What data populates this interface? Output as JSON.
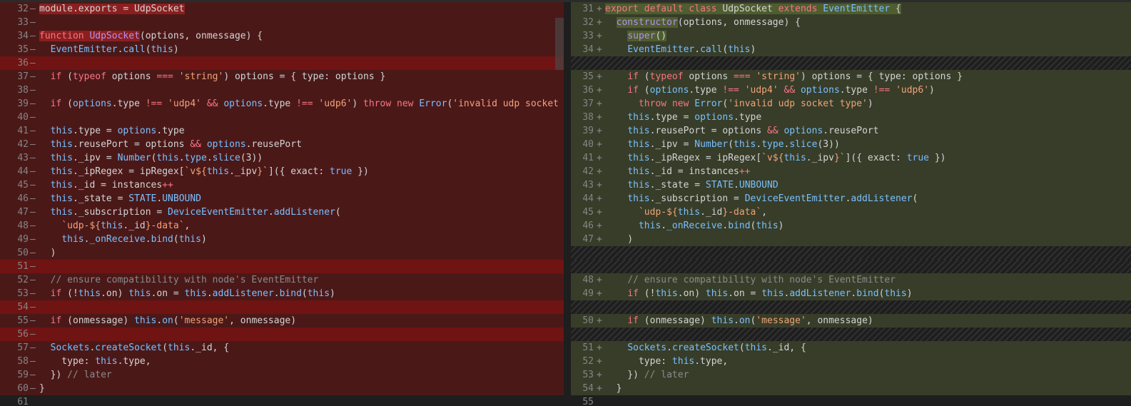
{
  "left": {
    "rows": [
      {
        "num": "32",
        "mk": "—",
        "bg": "del",
        "html": "<span class='hl-del'>module.exports = UdpSocket</span>"
      },
      {
        "num": "33",
        "mk": "—",
        "bg": "del",
        "html": ""
      },
      {
        "num": "34",
        "mk": "—",
        "bg": "del",
        "html": "<span class='hl-del'><span class='k'>function</span> <span class='pl'>UdpSocket</span></span>(options, onmessage) {"
      },
      {
        "num": "35",
        "mk": "—",
        "bg": "del",
        "html": "  <span class='t'>EventEmitter</span>.<span class='t'>call</span>(<span class='t'>this</span>)"
      },
      {
        "num": "36",
        "mk": "—",
        "bg": "gap",
        "html": ""
      },
      {
        "num": "37",
        "mk": "—",
        "bg": "del",
        "html": "  <span class='k'>if</span> (<span class='k'>typeof</span> options <span class='k'>===</span> <span class='s'>'string'</span>) options = { type: options }"
      },
      {
        "num": "38",
        "mk": "—",
        "bg": "del",
        "html": ""
      },
      {
        "num": "39",
        "mk": "—",
        "bg": "del",
        "html": "  <span class='k'>if</span> (<span class='t'>options</span>.type <span class='k'>!==</span> <span class='s'>'udp4'</span> <span class='k'>&amp;&amp;</span> <span class='t'>options</span>.type <span class='k'>!==</span> <span class='s'>'udp6'</span>) <span class='k'>throw</span> <span class='k'>new</span> <span class='t'>Error</span>(<span class='s'>'invalid udp socket typ</span>"
      },
      {
        "num": "40",
        "mk": "—",
        "bg": "del",
        "html": ""
      },
      {
        "num": "41",
        "mk": "—",
        "bg": "del",
        "html": "  <span class='t'>this</span>.type = <span class='t'>options</span>.type"
      },
      {
        "num": "42",
        "mk": "—",
        "bg": "del",
        "html": "  <span class='t'>this</span>.reusePort = options <span class='k'>&amp;&amp;</span> <span class='t'>options</span>.reusePort"
      },
      {
        "num": "43",
        "mk": "—",
        "bg": "del",
        "html": "  <span class='t'>this</span>._ipv = <span class='t'>Number</span>(<span class='t'>this</span>.<span class='t'>type</span>.<span class='t'>slice</span>(3))"
      },
      {
        "num": "44",
        "mk": "—",
        "bg": "del",
        "html": "  <span class='t'>this</span>._ipRegex = ipRegex[<span class='s'>`v${</span><span class='t'>this</span>._ipv<span class='s'>}`</span>]({ exact: <span class='n'>true</span> })"
      },
      {
        "num": "45",
        "mk": "—",
        "bg": "del",
        "html": "  <span class='t'>this</span>._id = instances<span class='k'>++</span>"
      },
      {
        "num": "46",
        "mk": "—",
        "bg": "del",
        "html": "  <span class='t'>this</span>._state = <span class='t'>STATE</span>.<span class='t'>UNBOUND</span>"
      },
      {
        "num": "47",
        "mk": "—",
        "bg": "del",
        "html": "  <span class='t'>this</span>._subscription = <span class='t'>DeviceEventEmitter</span>.<span class='t'>addListener</span>("
      },
      {
        "num": "48",
        "mk": "—",
        "bg": "del",
        "html": "    <span class='s'>`udp-${</span><span class='t'>this</span>._id<span class='s'>}-data`</span>,"
      },
      {
        "num": "49",
        "mk": "—",
        "bg": "del",
        "html": "    <span class='t'>this</span>.<span class='t'>_onReceive</span>.<span class='t'>bind</span>(<span class='t'>this</span>)"
      },
      {
        "num": "50",
        "mk": "—",
        "bg": "del",
        "html": "  )"
      },
      {
        "num": "51",
        "mk": "—",
        "bg": "gap",
        "html": ""
      },
      {
        "num": "52",
        "mk": "—",
        "bg": "del",
        "html": "  <span class='c'>// ensure compatibility with node's EventEmitter</span>"
      },
      {
        "num": "53",
        "mk": "—",
        "bg": "del",
        "html": "  <span class='k'>if</span> (!<span class='t'>this</span>.on) <span class='t'>this</span>.on = <span class='t'>this</span>.<span class='t'>addListener</span>.<span class='t'>bind</span>(<span class='t'>this</span>)"
      },
      {
        "num": "54",
        "mk": "—",
        "bg": "gap",
        "html": ""
      },
      {
        "num": "55",
        "mk": "—",
        "bg": "del",
        "html": "  <span class='k'>if</span> (onmessage) <span class='t'>this</span>.<span class='t'>on</span>(<span class='s'>'message'</span>, onmessage)"
      },
      {
        "num": "56",
        "mk": "—",
        "bg": "gap",
        "html": ""
      },
      {
        "num": "57",
        "mk": "—",
        "bg": "del",
        "html": "  <span class='t'>Sockets</span>.<span class='t'>createSocket</span>(<span class='t'>this</span>._id, {"
      },
      {
        "num": "58",
        "mk": "—",
        "bg": "del",
        "html": "    type: <span class='t'>this</span>.type,"
      },
      {
        "num": "59",
        "mk": "—",
        "bg": "del",
        "html": "  }) <span class='c'>// later</span>"
      },
      {
        "num": "60",
        "mk": "—",
        "bg": "del",
        "html": "}"
      },
      {
        "num": "61",
        "mk": "",
        "bg": "none",
        "html": ""
      }
    ]
  },
  "right": {
    "rows": [
      {
        "num": "31",
        "mk": "+",
        "bg": "add",
        "html": "<span class='hl-add'><span class='k'>export</span> <span class='k'>default</span> <span class='k'>class</span> UdpSocket <span class='k'>extends</span> <span class='t'>EventEmitter</span> {</span>"
      },
      {
        "num": "32",
        "mk": "+",
        "bg": "add",
        "html": "  <span class='hl-add'><span class='pl'>constructor</span></span>(options, onmessage) {"
      },
      {
        "num": "33",
        "mk": "+",
        "bg": "add",
        "html": "    <span class='hl-add'><span class='pl'>super</span>()</span>"
      },
      {
        "num": "34",
        "mk": "+",
        "bg": "add",
        "html": "    <span class='t'>EventEmitter</span>.<span class='t'>call</span>(<span class='t'>this</span>)"
      },
      {
        "num": "",
        "mk": "",
        "bg": "hatch",
        "html": ""
      },
      {
        "num": "35",
        "mk": "+",
        "bg": "add",
        "html": "    <span class='k'>if</span> (<span class='k'>typeof</span> options <span class='k'>===</span> <span class='s'>'string'</span>) options = { type: options }"
      },
      {
        "num": "36",
        "mk": "+",
        "bg": "add",
        "html": "    <span class='k'>if</span> (<span class='t'>options</span>.type <span class='k'>!==</span> <span class='s'>'udp4'</span> <span class='k'>&amp;&amp;</span> <span class='t'>options</span>.type <span class='k'>!==</span> <span class='s'>'udp6'</span>)"
      },
      {
        "num": "37",
        "mk": "+",
        "bg": "add",
        "html": "      <span class='k'>throw</span> <span class='k'>new</span> <span class='t'>Error</span>(<span class='s'>'invalid udp socket type'</span>)"
      },
      {
        "num": "38",
        "mk": "+",
        "bg": "add",
        "html": "    <span class='t'>this</span>.type = <span class='t'>options</span>.type"
      },
      {
        "num": "39",
        "mk": "+",
        "bg": "add",
        "html": "    <span class='t'>this</span>.reusePort = options <span class='k'>&amp;&amp;</span> <span class='t'>options</span>.reusePort"
      },
      {
        "num": "40",
        "mk": "+",
        "bg": "add",
        "html": "    <span class='t'>this</span>._ipv = <span class='t'>Number</span>(<span class='t'>this</span>.<span class='t'>type</span>.<span class='t'>slice</span>(3))"
      },
      {
        "num": "41",
        "mk": "+",
        "bg": "add",
        "html": "    <span class='t'>this</span>._ipRegex = ipRegex[<span class='s'>`v${</span><span class='t'>this</span>._ipv<span class='s'>}`</span>]({ exact: <span class='n'>true</span> })"
      },
      {
        "num": "42",
        "mk": "+",
        "bg": "add",
        "html": "    <span class='t'>this</span>._id = instances<span class='k'>++</span>"
      },
      {
        "num": "43",
        "mk": "+",
        "bg": "add",
        "html": "    <span class='t'>this</span>._state = <span class='t'>STATE</span>.<span class='t'>UNBOUND</span>"
      },
      {
        "num": "44",
        "mk": "+",
        "bg": "add",
        "html": "    <span class='t'>this</span>._subscription = <span class='t'>DeviceEventEmitter</span>.<span class='t'>addListener</span>("
      },
      {
        "num": "45",
        "mk": "+",
        "bg": "add",
        "html": "      <span class='s'>`udp-${</span><span class='t'>this</span>._id<span class='s'>}-data`</span>,"
      },
      {
        "num": "46",
        "mk": "+",
        "bg": "add",
        "html": "      <span class='t'>this</span>.<span class='t'>_onReceive</span>.<span class='t'>bind</span>(<span class='t'>this</span>)"
      },
      {
        "num": "47",
        "mk": "+",
        "bg": "add",
        "html": "    )"
      },
      {
        "num": "",
        "mk": "",
        "bg": "hatch",
        "html": ""
      },
      {
        "num": "",
        "mk": "",
        "bg": "hatch",
        "html": ""
      },
      {
        "num": "48",
        "mk": "+",
        "bg": "add",
        "html": "    <span class='c'>// ensure compatibility with node's EventEmitter</span>"
      },
      {
        "num": "49",
        "mk": "+",
        "bg": "add",
        "html": "    <span class='k'>if</span> (!<span class='t'>this</span>.on) <span class='t'>this</span>.on = <span class='t'>this</span>.<span class='t'>addListener</span>.<span class='t'>bind</span>(<span class='t'>this</span>)"
      },
      {
        "num": "",
        "mk": "",
        "bg": "hatch",
        "html": ""
      },
      {
        "num": "50",
        "mk": "+",
        "bg": "add",
        "html": "    <span class='k'>if</span> (onmessage) <span class='t'>this</span>.<span class='t'>on</span>(<span class='s'>'message'</span>, onmessage)"
      },
      {
        "num": "",
        "mk": "",
        "bg": "hatch",
        "html": ""
      },
      {
        "num": "51",
        "mk": "+",
        "bg": "add",
        "html": "    <span class='t'>Sockets</span>.<span class='t'>createSocket</span>(<span class='t'>this</span>._id, {"
      },
      {
        "num": "52",
        "mk": "+",
        "bg": "add",
        "html": "      type: <span class='t'>this</span>.type,"
      },
      {
        "num": "53",
        "mk": "+",
        "bg": "add",
        "html": "    }) <span class='c'>// later</span>"
      },
      {
        "num": "54",
        "mk": "+",
        "bg": "add",
        "html": "  }"
      },
      {
        "num": "55",
        "mk": "",
        "bg": "none",
        "html": ""
      }
    ]
  },
  "colors": {
    "deleted_bg": "#4b1818",
    "added_bg": "#373d29",
    "gap_bg": "#6f1313"
  }
}
